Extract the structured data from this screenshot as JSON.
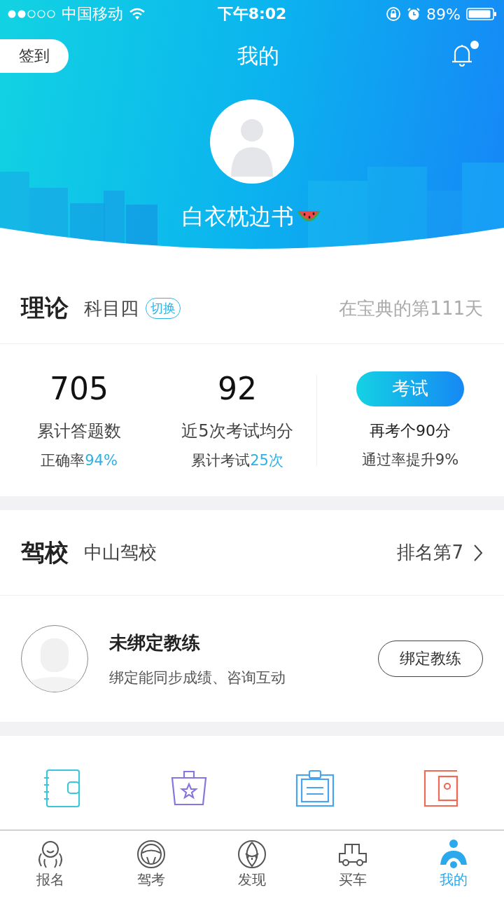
{
  "status_bar": {
    "carrier": "中国移动",
    "time": "下午8:02",
    "battery": "89%"
  },
  "header": {
    "checkin_button": "签到",
    "title": "我的",
    "notifications": {
      "unread": true
    }
  },
  "profile": {
    "name": "白衣枕边书"
  },
  "theory": {
    "title": "理论",
    "subject": "科目四",
    "switch_button": "切换",
    "days": "在宝典的第111天",
    "stats": [
      {
        "value": "705",
        "label": "累计答题数",
        "sub_label": "正确率",
        "sub_value": "94%"
      },
      {
        "value": "92",
        "label": "近5次考试均分",
        "sub_label": "累计考试",
        "sub_value": "25次"
      }
    ],
    "exam_button": "考试",
    "hint": "再考个90分",
    "hint_sub": "通过率提升9%"
  },
  "school": {
    "title": "驾校",
    "name": "中山驾校",
    "rank": "排名第7"
  },
  "coach": {
    "title": "未绑定教练",
    "subtitle": "绑定能同步成绩、咨询互动",
    "bind_button": "绑定教练"
  },
  "shortcuts": [
    {
      "kind": "notebook"
    },
    {
      "kind": "bag"
    },
    {
      "kind": "clipboard"
    },
    {
      "kind": "wallet"
    }
  ],
  "tab_bar": [
    {
      "label": "报名",
      "kind": "face",
      "selected": false
    },
    {
      "label": "驾考",
      "kind": "wheel",
      "selected": false
    },
    {
      "label": "发现",
      "kind": "eye",
      "selected": false
    },
    {
      "label": "买车",
      "kind": "car",
      "selected": false
    },
    {
      "label": "我的",
      "kind": "driver",
      "selected": true
    }
  ]
}
